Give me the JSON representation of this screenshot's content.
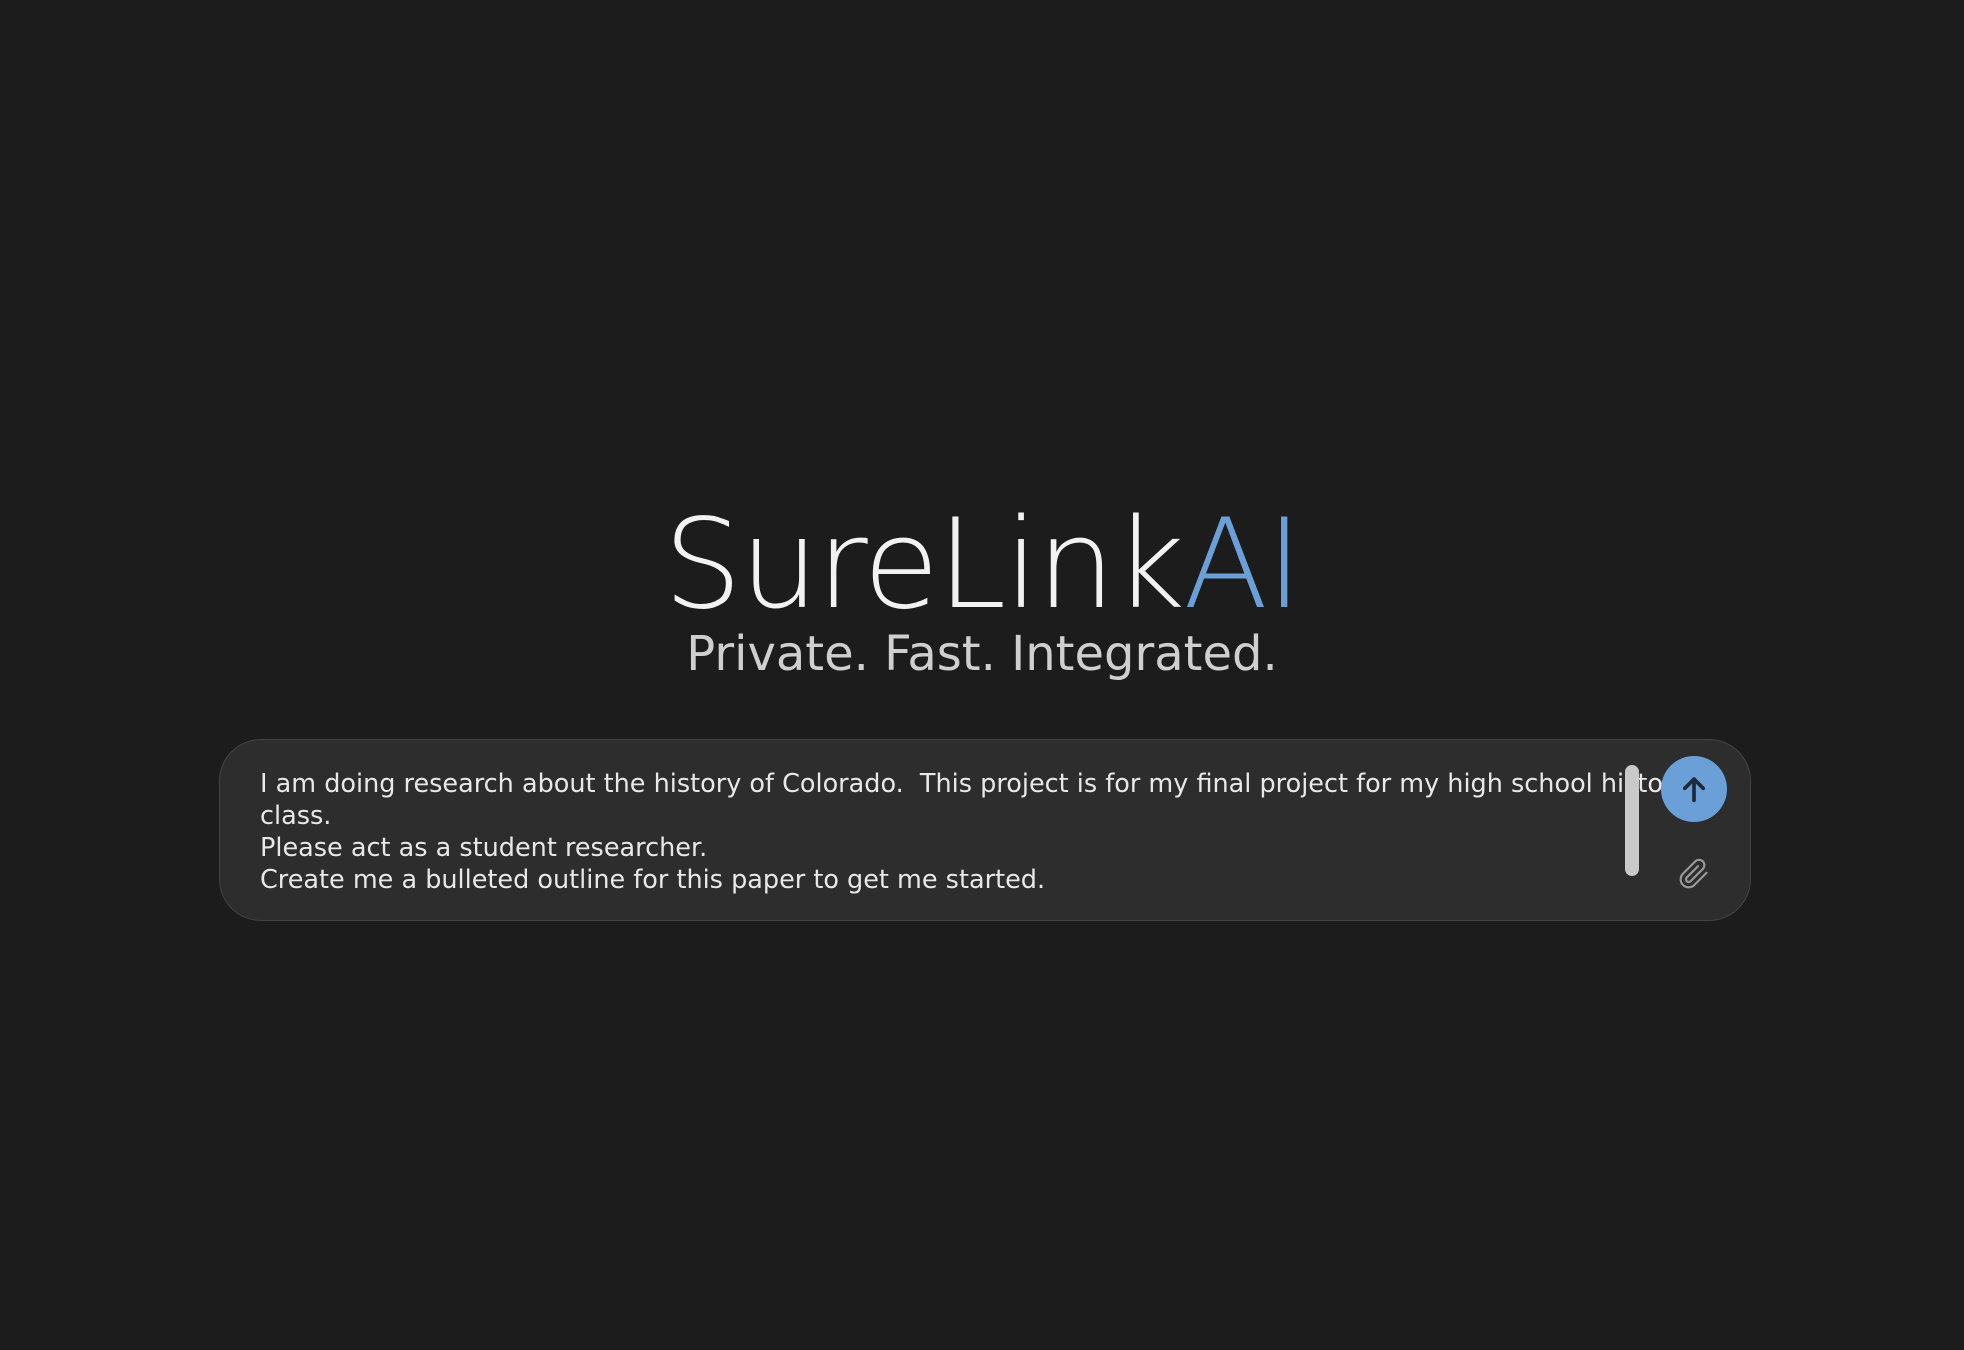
{
  "brand": {
    "name_main": "SureLink",
    "name_accent": "AI",
    "tagline": "Private. Fast. Integrated."
  },
  "composer": {
    "prompt_text": "I am doing research about the history of Colorado.  This project is for my final project for my high school history class.\nPlease act as a student researcher.\nCreate me a bulleted outline for this paper to get me started.",
    "send_icon": "arrow-up-icon",
    "attach_icon": "paperclip-icon"
  },
  "colors": {
    "background": "#1c1c1c",
    "composer_background": "#2d2d2d",
    "accent": "#6a9fd8",
    "text": "#e8e8e8"
  }
}
